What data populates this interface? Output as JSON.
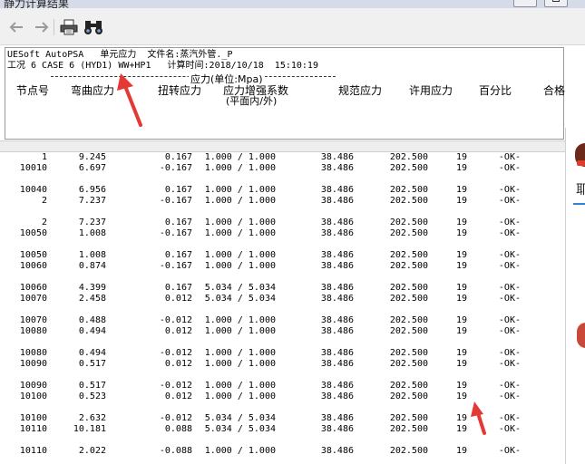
{
  "window": {
    "title": "静力计算结果"
  },
  "toolbar": {
    "back_icon": "arrow-left-icon",
    "forward_icon": "arrow-right-icon",
    "print_icon": "printer-icon",
    "find_icon": "binoculars-icon"
  },
  "report": {
    "line1": "UESoft AutoPSA   单元应力  文件名:蒸汽外管._P",
    "line2": "工况 6 CASE 6 (HYD1) WW+HP1   计算时间:2018/10/18  15:10:19",
    "section_label": "应力(单位:Mpa)",
    "columns": {
      "node": "节点号",
      "bending": "弯曲应力",
      "torsion": "扭转应力",
      "sif": "应力增强系数",
      "sif_sub": "(平面内/外)",
      "code": "规范应力",
      "allowable": "许用应力",
      "percent": "百分比",
      "status": "合格"
    }
  },
  "groups": [
    [
      {
        "node": "1",
        "bend": "9.245",
        "tor": "0.167",
        "sif": "1.000 / 1.000",
        "code": "38.486",
        "allow": "202.500",
        "pct": "19",
        "ok": "-OK-"
      },
      {
        "node": "10010",
        "bend": "6.697",
        "tor": "-0.167",
        "sif": "1.000 / 1.000",
        "code": "38.486",
        "allow": "202.500",
        "pct": "19",
        "ok": "-OK-"
      }
    ],
    [
      {
        "node": "10040",
        "bend": "6.956",
        "tor": "0.167",
        "sif": "1.000 / 1.000",
        "code": "38.486",
        "allow": "202.500",
        "pct": "19",
        "ok": "-OK-"
      },
      {
        "node": "2",
        "bend": "7.237",
        "tor": "-0.167",
        "sif": "1.000 / 1.000",
        "code": "38.486",
        "allow": "202.500",
        "pct": "19",
        "ok": "-OK-"
      }
    ],
    [
      {
        "node": "2",
        "bend": "7.237",
        "tor": "0.167",
        "sif": "1.000 / 1.000",
        "code": "38.486",
        "allow": "202.500",
        "pct": "19",
        "ok": "-OK-"
      },
      {
        "node": "10050",
        "bend": "1.008",
        "tor": "-0.167",
        "sif": "1.000 / 1.000",
        "code": "38.486",
        "allow": "202.500",
        "pct": "19",
        "ok": "-OK-"
      }
    ],
    [
      {
        "node": "10050",
        "bend": "1.008",
        "tor": "0.167",
        "sif": "1.000 / 1.000",
        "code": "38.486",
        "allow": "202.500",
        "pct": "19",
        "ok": "-OK-"
      },
      {
        "node": "10060",
        "bend": "0.874",
        "tor": "-0.167",
        "sif": "1.000 / 1.000",
        "code": "38.486",
        "allow": "202.500",
        "pct": "19",
        "ok": "-OK-"
      }
    ],
    [
      {
        "node": "10060",
        "bend": "4.399",
        "tor": "0.167",
        "sif": "5.034 / 5.034",
        "code": "38.486",
        "allow": "202.500",
        "pct": "19",
        "ok": "-OK-"
      },
      {
        "node": "10070",
        "bend": "2.458",
        "tor": "0.012",
        "sif": "5.034 / 5.034",
        "code": "38.486",
        "allow": "202.500",
        "pct": "19",
        "ok": "-OK-"
      }
    ],
    [
      {
        "node": "10070",
        "bend": "0.488",
        "tor": "-0.012",
        "sif": "1.000 / 1.000",
        "code": "38.486",
        "allow": "202.500",
        "pct": "19",
        "ok": "-OK-"
      },
      {
        "node": "10080",
        "bend": "0.494",
        "tor": "0.012",
        "sif": "1.000 / 1.000",
        "code": "38.486",
        "allow": "202.500",
        "pct": "19",
        "ok": "-OK-"
      }
    ],
    [
      {
        "node": "10080",
        "bend": "0.494",
        "tor": "-0.012",
        "sif": "1.000 / 1.000",
        "code": "38.486",
        "allow": "202.500",
        "pct": "19",
        "ok": "-OK-"
      },
      {
        "node": "10090",
        "bend": "0.517",
        "tor": "0.012",
        "sif": "1.000 / 1.000",
        "code": "38.486",
        "allow": "202.500",
        "pct": "19",
        "ok": "-OK-"
      }
    ],
    [
      {
        "node": "10090",
        "bend": "0.517",
        "tor": "-0.012",
        "sif": "1.000 / 1.000",
        "code": "38.486",
        "allow": "202.500",
        "pct": "19",
        "ok": "-OK-"
      },
      {
        "node": "10100",
        "bend": "0.523",
        "tor": "0.012",
        "sif": "1.000 / 1.000",
        "code": "38.486",
        "allow": "202.500",
        "pct": "19",
        "ok": "-OK-"
      }
    ],
    [
      {
        "node": "10100",
        "bend": "2.632",
        "tor": "-0.012",
        "sif": "5.034 / 5.034",
        "code": "38.486",
        "allow": "202.500",
        "pct": "19",
        "ok": "-OK-"
      },
      {
        "node": "10110",
        "bend": "10.181",
        "tor": "0.088",
        "sif": "5.034 / 5.034",
        "code": "38.486",
        "allow": "202.500",
        "pct": "19",
        "ok": "-OK-"
      }
    ],
    [
      {
        "node": "10110",
        "bend": "2.022",
        "tor": "-0.088",
        "sif": "1.000 / 1.000",
        "code": "38.486",
        "allow": "202.500",
        "pct": "19",
        "ok": "-OK-"
      }
    ]
  ],
  "side_panel": {
    "tab_char": "耶"
  },
  "annotation_color": "#e53935"
}
